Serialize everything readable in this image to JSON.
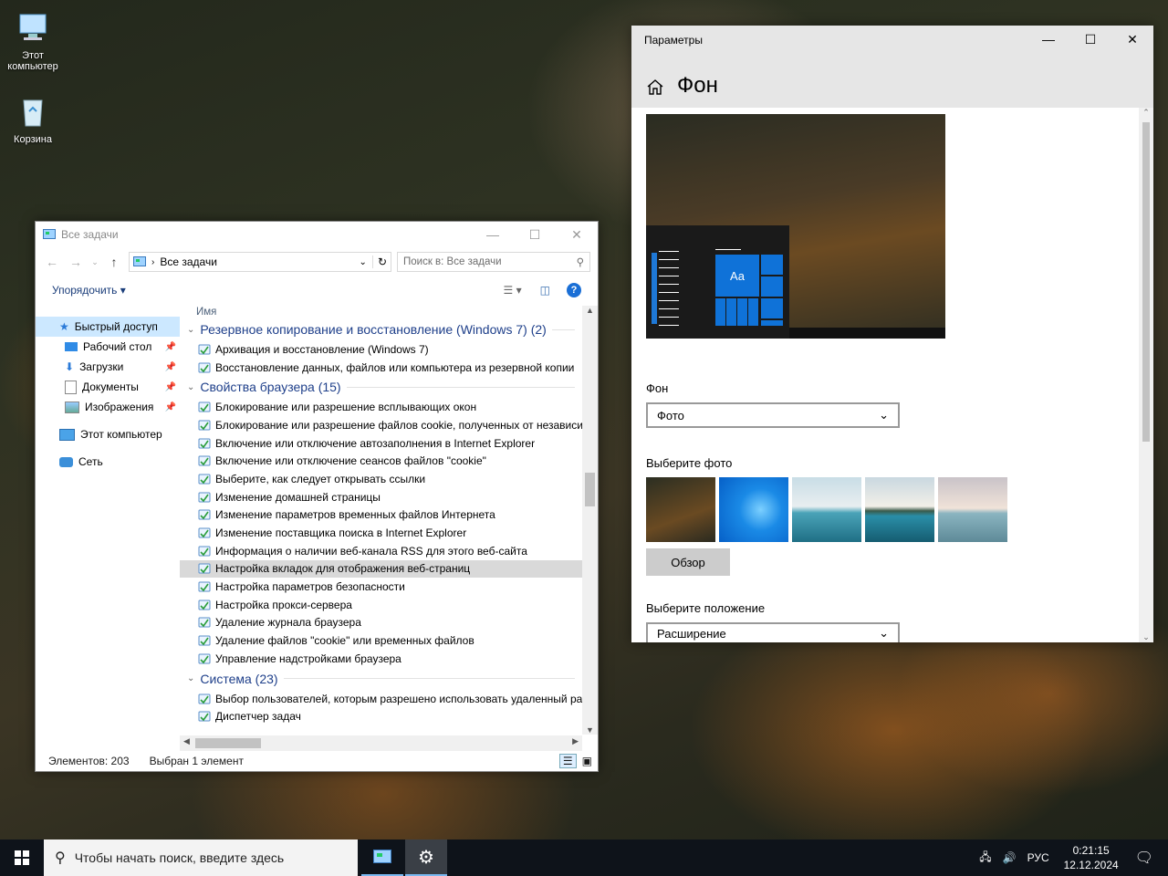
{
  "desktop": {
    "icons": [
      {
        "label_line1": "Этот",
        "label_line2": "компьютер"
      },
      {
        "label_line1": "Корзина",
        "label_line2": ""
      }
    ]
  },
  "explorer": {
    "title": "Все задачи",
    "address": "Все задачи",
    "search_placeholder": "Поиск в: Все задачи",
    "organize_label": "Упорядочить",
    "column_header": "Имя",
    "nav": [
      {
        "label": "Быстрый доступ"
      },
      {
        "label": "Рабочий стол"
      },
      {
        "label": "Загрузки"
      },
      {
        "label": "Документы"
      },
      {
        "label": "Изображения"
      },
      {
        "label": "Этот компьютер"
      },
      {
        "label": "Сеть"
      }
    ],
    "groups": [
      {
        "title": "Резервное копирование и восстановление (Windows 7) (2)",
        "items": [
          "Архивация и восстановление (Windows 7)",
          "Восстановление данных, файлов или компьютера из резервной копии"
        ]
      },
      {
        "title": "Свойства браузера (15)",
        "items": [
          "Блокирование или разрешение всплывающих окон",
          "Блокирование или разрешение файлов cookie, полученных от независи",
          "Включение или отключение автозаполнения в Internet Explorer",
          "Включение или отключение сеансов файлов \"cookie\"",
          "Выберите, как следует открывать ссылки",
          "Изменение домашней страницы",
          "Изменение параметров временных файлов Интернета",
          "Изменение поставщика поиска в Internet Explorer",
          "Информация о наличии веб-канала RSS для этого веб-сайта",
          "Настройка вкладок для отображения веб-страниц",
          "Настройка параметров безопасности",
          "Настройка прокси-сервера",
          "Удаление журнала браузера",
          "Удаление файлов \"cookie\" или временных файлов",
          "Управление надстройками браузера"
        ]
      },
      {
        "title": "Система (23)",
        "items": [
          "Выбор пользователей, которым разрешено использовать удаленный ра",
          "Диспетчер задач"
        ]
      }
    ],
    "selected_item": "Настройка вкладок для отображения веб-страниц",
    "status_count": "Элементов: 203",
    "status_selected": "Выбран 1 элемент"
  },
  "settings": {
    "window_title": "Параметры",
    "page_title": "Фон",
    "preview_tile_text": "Aa",
    "background_label": "Фон",
    "background_value": "Фото",
    "choose_photo_label": "Выберите фото",
    "browse_label": "Обзор",
    "position_label": "Выберите положение",
    "position_value": "Расширение"
  },
  "taskbar": {
    "search_placeholder": "Чтобы начать поиск, введите здесь",
    "language": "РУС",
    "time": "0:21:15",
    "date": "12.12.2024"
  }
}
